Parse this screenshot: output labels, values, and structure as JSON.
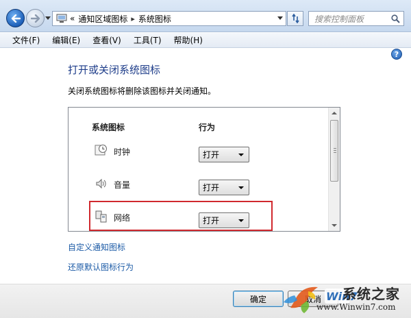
{
  "address_bar": {
    "overflow_chevron": "«",
    "breadcrumb": [
      "通知区域图标",
      "系统图标"
    ],
    "separator": "▸"
  },
  "search": {
    "placeholder": "搜索控制面板"
  },
  "menu": [
    "文件(F)",
    "编辑(E)",
    "查看(V)",
    "工具(T)",
    "帮助(H)"
  ],
  "help_glyph": "?",
  "page": {
    "title": "打开或关闭系统图标",
    "description": "关闭系统图标将删除该图标并关闭通知。"
  },
  "table": {
    "col_icon": "系统图标",
    "col_behavior": "行为",
    "rows": [
      {
        "icon": "clock-icon",
        "label": "时钟",
        "value": "打开"
      },
      {
        "icon": "volume-icon",
        "label": "音量",
        "value": "打开"
      },
      {
        "icon": "network-icon",
        "label": "网络",
        "value": "打开"
      }
    ]
  },
  "links": {
    "customize": "自定义通知图标",
    "restore": "还原默认图标行为"
  },
  "buttons": {
    "ok": "确定",
    "cancel": "取消"
  },
  "watermark": {
    "title": "系统之家",
    "logo_text": "Win7",
    "url": "www.Winwin7.com"
  },
  "colors": {
    "heading": "#1e3d8a",
    "link": "#1b5aa6",
    "highlight": "#d0282d"
  }
}
